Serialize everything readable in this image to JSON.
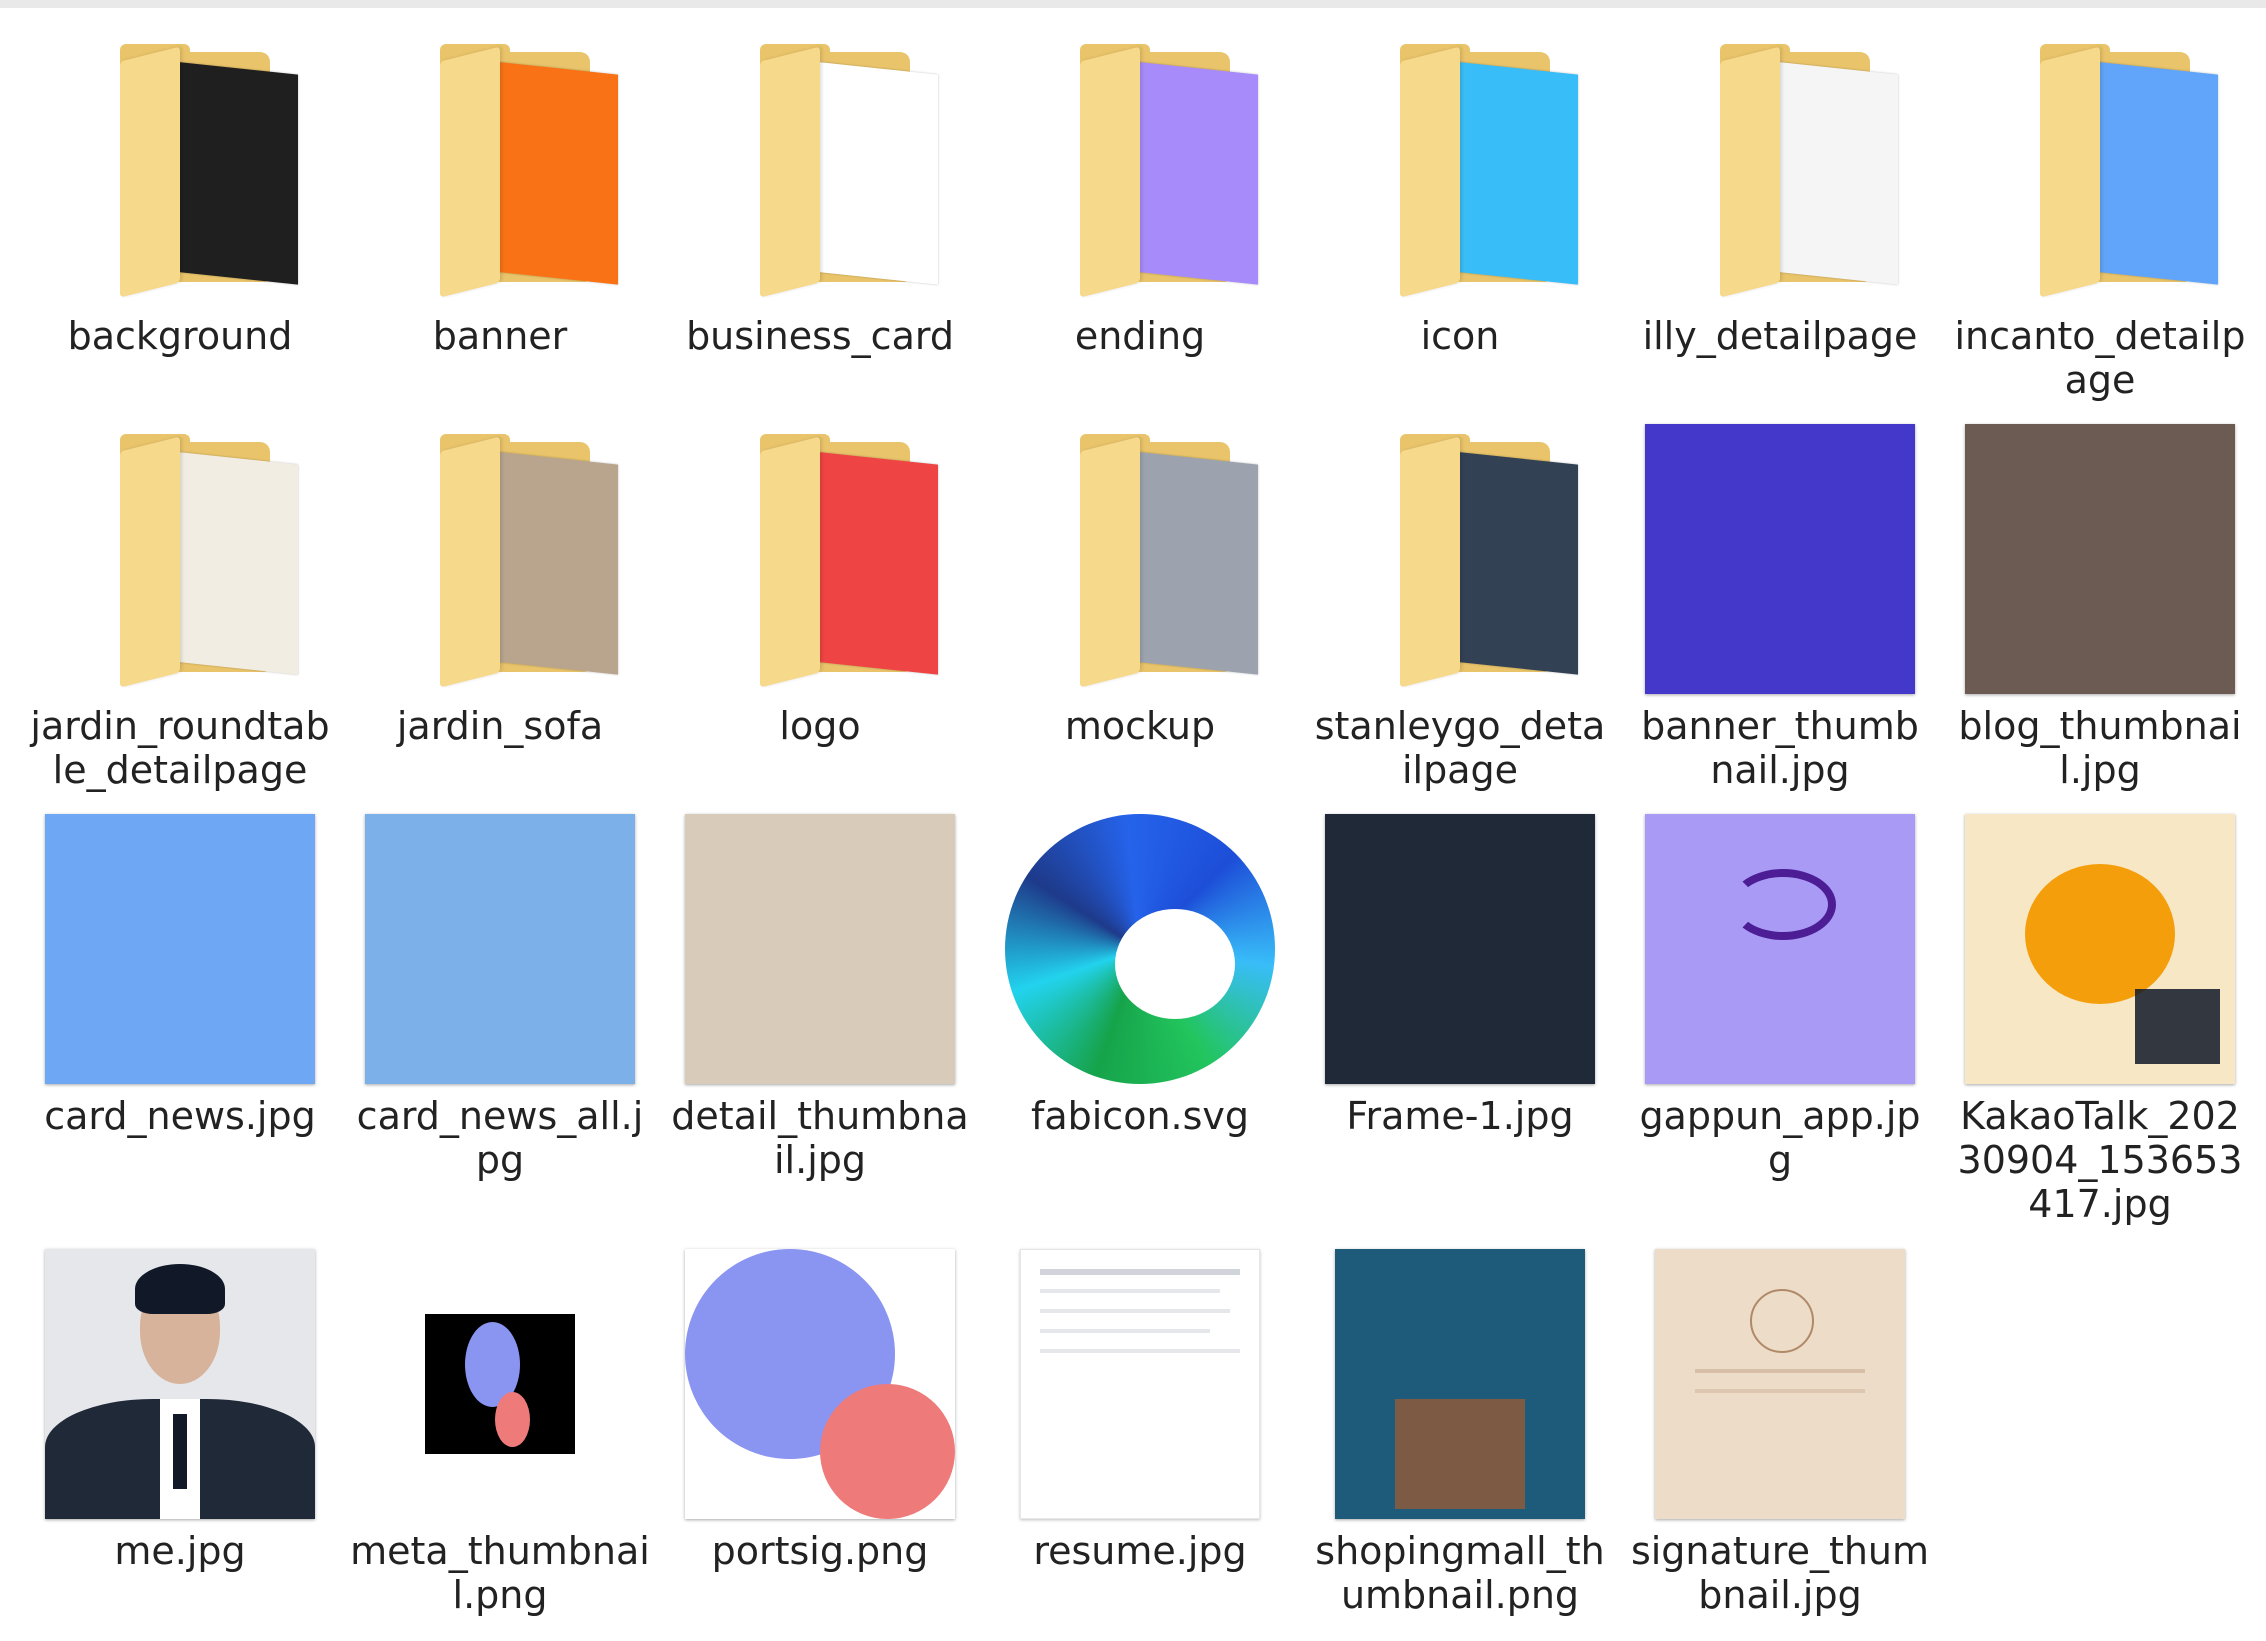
{
  "items": [
    {
      "type": "folder",
      "label": "background",
      "icon": "folder-icon",
      "paper": "#1f1f1f"
    },
    {
      "type": "folder",
      "label": "banner",
      "icon": "folder-icon",
      "paper": "#f97316"
    },
    {
      "type": "folder",
      "label": "business_card",
      "icon": "folder-icon",
      "paper": "#ffffff"
    },
    {
      "type": "folder",
      "label": "ending",
      "icon": "folder-icon",
      "paper": "#a78bfa"
    },
    {
      "type": "folder",
      "label": "icon",
      "icon": "folder-icon",
      "paper": "#38bdf8"
    },
    {
      "type": "folder",
      "label": "illy_detailpage",
      "icon": "folder-icon",
      "paper": "#f5f5f5"
    },
    {
      "type": "folder",
      "label": "incanto_detailpage",
      "icon": "folder-icon",
      "paper": "#60a5fa"
    },
    {
      "type": "folder",
      "label": "jardin_roundtable_detailpage",
      "icon": "folder-icon",
      "paper": "#f1ede3"
    },
    {
      "type": "folder",
      "label": "jardin_sofa",
      "icon": "folder-icon",
      "paper": "#b9a58e"
    },
    {
      "type": "folder",
      "label": "logo",
      "icon": "folder-icon",
      "paper": "#ef4444"
    },
    {
      "type": "folder",
      "label": "mockup",
      "icon": "folder-icon",
      "paper": "#9ca3af"
    },
    {
      "type": "folder",
      "label": "stanleygo_detailpage",
      "icon": "folder-icon",
      "paper": "#334155"
    },
    {
      "type": "image",
      "label": "banner_thumbnail.jpg",
      "icon": "image-thumbnail-icon",
      "bg": "#4338ca"
    },
    {
      "type": "image",
      "label": "blog_thumbnail.jpg",
      "icon": "image-thumbnail-icon",
      "bg": "#6b5b53"
    },
    {
      "type": "image",
      "label": "card_news.jpg",
      "icon": "image-thumbnail-icon",
      "bg": "#6ea8f5"
    },
    {
      "type": "image",
      "label": "card_news_all.jpg",
      "icon": "image-thumbnail-icon",
      "bg": "#7cb0e8"
    },
    {
      "type": "image",
      "label": "detail_thumbnail.jpg",
      "icon": "image-thumbnail-icon",
      "bg": "#d8cbb9"
    },
    {
      "type": "svg",
      "label": "fabicon.svg",
      "icon": "edge-logo-icon",
      "bg": "#2563eb"
    },
    {
      "type": "image",
      "label": "Frame-1.jpg",
      "icon": "image-thumbnail-icon",
      "bg": "#1f2937"
    },
    {
      "type": "image",
      "label": "gappun_app.jpg",
      "icon": "image-thumbnail-icon",
      "bg": "#a99af6"
    },
    {
      "type": "image",
      "label": "KakaoTalk_20230904_153653417.jpg",
      "icon": "image-thumbnail-icon",
      "bg": "#f7e7c5"
    },
    {
      "type": "image",
      "label": "me.jpg",
      "icon": "image-thumbnail-icon",
      "bg": "#e5e7eb"
    },
    {
      "type": "image",
      "label": "meta_thumbnail.png",
      "icon": "image-thumbnail-icon",
      "bg": "#000000"
    },
    {
      "type": "image",
      "label": "portsig.png",
      "icon": "image-thumbnail-icon",
      "bg": "#ffffff"
    },
    {
      "type": "image",
      "label": "resume.jpg",
      "icon": "image-thumbnail-icon",
      "bg": "#ffffff"
    },
    {
      "type": "image",
      "label": "shopingmall_thumbnail.png",
      "icon": "image-thumbnail-icon",
      "bg": "#1e5a7a"
    },
    {
      "type": "image",
      "label": "signature_thumbnail.jpg",
      "icon": "image-thumbnail-icon",
      "bg": "#ecdcc8"
    }
  ]
}
